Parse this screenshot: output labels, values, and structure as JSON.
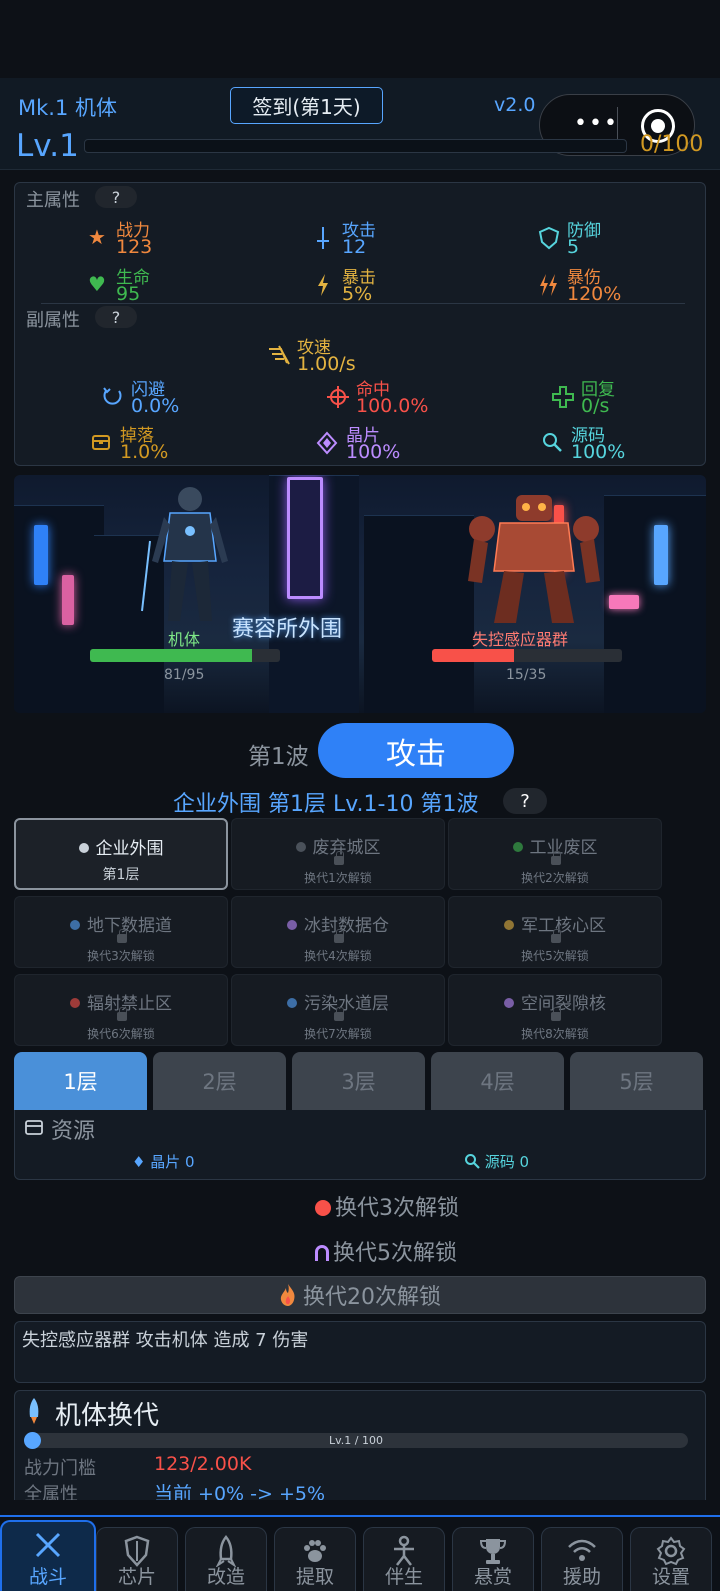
{
  "header": {
    "title": "Mk.1 机体",
    "checkin_label": "签到(第1天)",
    "version": "v2.0",
    "level": "Lv.1",
    "xp_text": "0/100",
    "xp_progress": 0
  },
  "main_stats": {
    "label": "主属性",
    "help": "?",
    "items": [
      {
        "name": "战力",
        "value": "123",
        "icon": "star-icon",
        "color": "#f0883e"
      },
      {
        "name": "攻击",
        "value": "12",
        "icon": "sword-icon",
        "color": "#58a6ff"
      },
      {
        "name": "防御",
        "value": "5",
        "icon": "shield-icon",
        "color": "#56d4dd"
      },
      {
        "name": "生命",
        "value": "95",
        "icon": "heart-icon",
        "color": "#3fb950"
      },
      {
        "name": "暴击",
        "value": "5%",
        "icon": "bolt-icon",
        "color": "#e3b341"
      },
      {
        "name": "暴伤",
        "value": "120%",
        "icon": "double-bolt-icon",
        "color": "#f0883e"
      }
    ]
  },
  "sub_stats": {
    "label": "副属性",
    "help": "?",
    "items": [
      {
        "name": "攻速",
        "value": "1.00/s",
        "icon": "speed-icon",
        "color": "#e3b341"
      },
      {
        "name": "闪避",
        "value": "0.0%",
        "icon": "dodge-icon",
        "color": "#58a6ff"
      },
      {
        "name": "命中",
        "value": "100.0%",
        "icon": "crosshair-icon",
        "color": "#f85149"
      },
      {
        "name": "回复",
        "value": "0/s",
        "icon": "plus-icon",
        "color": "#3fb950"
      },
      {
        "name": "掉落",
        "value": "1.0%",
        "icon": "chest-icon",
        "color": "#d29922"
      },
      {
        "name": "晶片",
        "value": "100%",
        "icon": "diamond-icon",
        "color": "#bc8cff"
      },
      {
        "name": "源码",
        "value": "100%",
        "icon": "search-icon",
        "color": "#56d4dd"
      }
    ]
  },
  "battle": {
    "scene_sign": "赛容所外围",
    "player": {
      "name": "机体",
      "hp_text": "81/95",
      "hp_ratio": 0.853,
      "color": "#3fb950"
    },
    "enemy": {
      "name": "失控感应器群",
      "hp_text": "15/35",
      "hp_ratio": 0.43,
      "color": "#f85149"
    },
    "wave_label": "第1波",
    "attack_label": "攻击"
  },
  "area_info": {
    "text": "企业外围  第1层   Lv.1-10   第1波",
    "help": "?"
  },
  "zones": [
    {
      "name": "企业外围",
      "sub": "第1层",
      "dot": "#c9d1d9",
      "locked": false
    },
    {
      "name": "废弃城区",
      "sub": "换代1次解锁",
      "dot": "#6e7681",
      "locked": true
    },
    {
      "name": "工业废区",
      "sub": "换代2次解锁",
      "dot": "#3fb950",
      "locked": true
    },
    {
      "name": "地下数据道",
      "sub": "换代3次解锁",
      "dot": "#58a6ff",
      "locked": true
    },
    {
      "name": "冰封数据仓",
      "sub": "换代4次解锁",
      "dot": "#bc8cff",
      "locked": true
    },
    {
      "name": "军工核心区",
      "sub": "换代5次解锁",
      "dot": "#e3b341",
      "locked": true
    },
    {
      "name": "辐射禁止区",
      "sub": "换代6次解锁",
      "dot": "#f85149",
      "locked": true
    },
    {
      "name": "污染水道层",
      "sub": "换代7次解锁",
      "dot": "#58a6ff",
      "locked": true
    },
    {
      "name": "空间裂隙核",
      "sub": "换代8次解锁",
      "dot": "#bc8cff",
      "locked": true
    }
  ],
  "floors": [
    "1层",
    "2层",
    "3层",
    "4层",
    "5层"
  ],
  "resources": {
    "title": "资源",
    "chip": "晶片 0",
    "code": "源码 0"
  },
  "unlocks": {
    "u3": "换代3次解锁",
    "u5": "换代5次解锁",
    "u20": "换代20次解锁"
  },
  "log": {
    "text": "失控感应器群 攻击机体 造成 7 伤害"
  },
  "evolution": {
    "title": "机体换代",
    "bar_label": "Lv.1 / 100",
    "threshold_label": "战力门槛",
    "threshold_value": "123/2.00K",
    "attr_label": "全属性",
    "attr_value": "当前 +0%  ->  +5%"
  },
  "tabs": [
    {
      "label": "战斗",
      "icon": "crossed-swords-icon"
    },
    {
      "label": "芯片",
      "icon": "shield-icon"
    },
    {
      "label": "改造",
      "icon": "rocket-icon"
    },
    {
      "label": "提取",
      "icon": "paw-icon"
    },
    {
      "label": "伴生",
      "icon": "person-icon"
    },
    {
      "label": "悬赏",
      "icon": "trophy-icon"
    },
    {
      "label": "援助",
      "icon": "signal-icon"
    },
    {
      "label": "设置",
      "icon": "gear-icon"
    }
  ]
}
